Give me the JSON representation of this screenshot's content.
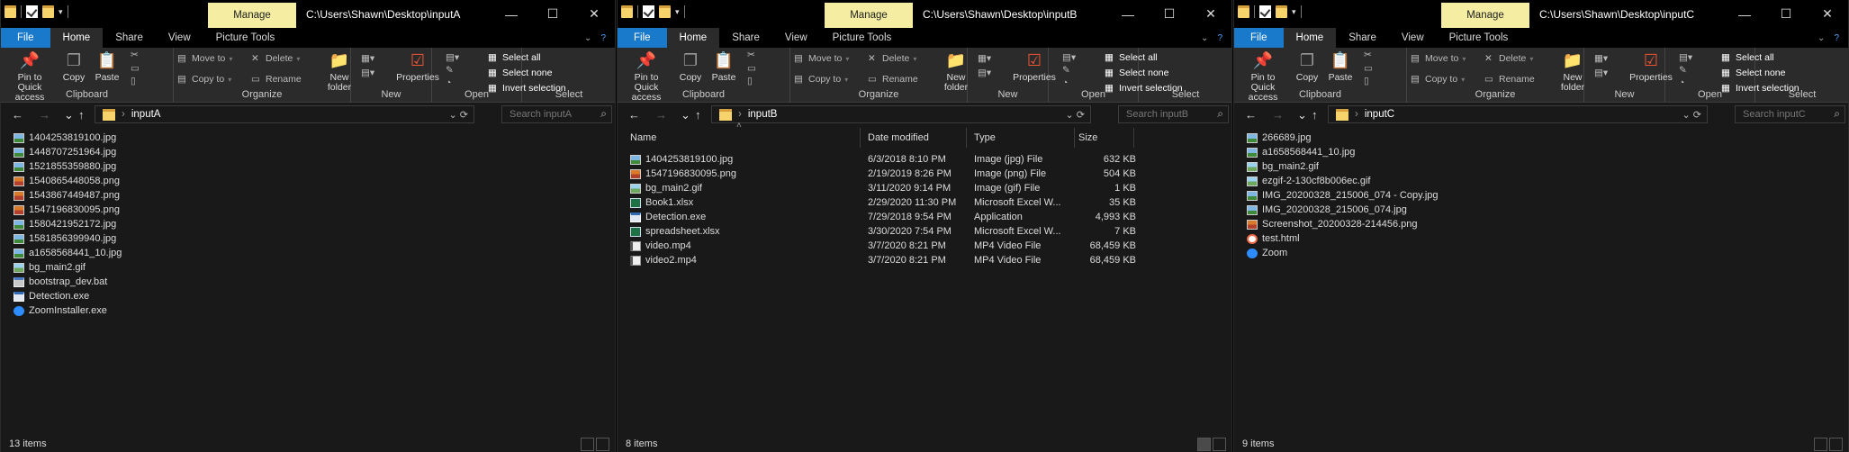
{
  "windows": [
    {
      "title": "C:\\Users\\Shawn\\Desktop\\inputA",
      "manage": "Manage",
      "tabs": [
        "File",
        "Home",
        "Share",
        "View",
        "Picture Tools"
      ],
      "ribbon": {
        "pin": "Pin to Quick access",
        "copy": "Copy",
        "paste": "Paste",
        "moveto": "Move to",
        "copyto": "Copy to",
        "delete": "Delete",
        "rename": "Rename",
        "newfolder": "New folder",
        "properties": "Properties",
        "selectall": "Select all",
        "selectnone": "Select none",
        "invert": "Invert selection",
        "groups": [
          "Clipboard",
          "Organize",
          "New",
          "Open",
          "Select"
        ]
      },
      "address": "inputA",
      "search_placeholder": "Search inputA",
      "view": "list",
      "files": [
        {
          "name": "1404253819100.jpg",
          "icon": "jpg"
        },
        {
          "name": "1448707251964.jpg",
          "icon": "jpg"
        },
        {
          "name": "1521855359880.jpg",
          "icon": "jpg"
        },
        {
          "name": "1540865448058.png",
          "icon": "png"
        },
        {
          "name": "1543867449487.png",
          "icon": "png"
        },
        {
          "name": "1547196830095.png",
          "icon": "png"
        },
        {
          "name": "1580421952172.jpg",
          "icon": "jpg"
        },
        {
          "name": "1581856399940.jpg",
          "icon": "jpg"
        },
        {
          "name": "a1658568441_10.jpg",
          "icon": "jpg"
        },
        {
          "name": "bg_main2.gif",
          "icon": "gif"
        },
        {
          "name": "bootstrap_dev.bat",
          "icon": "bat"
        },
        {
          "name": "Detection.exe",
          "icon": "exe"
        },
        {
          "name": "ZoomInstaller.exe",
          "icon": "zoomi"
        }
      ],
      "status": "13 items"
    },
    {
      "title": "C:\\Users\\Shawn\\Desktop\\inputB",
      "manage": "Manage",
      "tabs": [
        "File",
        "Home",
        "Share",
        "View",
        "Picture Tools"
      ],
      "ribbon": {
        "pin": "Pin to Quick access",
        "copy": "Copy",
        "paste": "Paste",
        "moveto": "Move to",
        "copyto": "Copy to",
        "delete": "Delete",
        "rename": "Rename",
        "newfolder": "New folder",
        "properties": "Properties",
        "selectall": "Select all",
        "selectnone": "Select none",
        "invert": "Invert selection",
        "groups": [
          "Clipboard",
          "Organize",
          "New",
          "Open",
          "Select"
        ]
      },
      "address": "inputB",
      "search_placeholder": "Search inputB",
      "view": "details",
      "columns": [
        "Name",
        "Date modified",
        "Type",
        "Size"
      ],
      "files": [
        {
          "name": "1404253819100.jpg",
          "icon": "jpg",
          "date": "6/3/2018 8:10 PM",
          "type": "Image (jpg) File",
          "size": "632 KB"
        },
        {
          "name": "1547196830095.png",
          "icon": "png",
          "date": "2/19/2019 8:26 PM",
          "type": "Image (png) File",
          "size": "504 KB"
        },
        {
          "name": "bg_main2.gif",
          "icon": "gif",
          "date": "3/11/2020 9:14 PM",
          "type": "Image (gif) File",
          "size": "1 KB"
        },
        {
          "name": "Book1.xlsx",
          "icon": "xls",
          "date": "2/29/2020 11:30 PM",
          "type": "Microsoft Excel W...",
          "size": "35 KB"
        },
        {
          "name": "Detection.exe",
          "icon": "exe",
          "date": "7/29/2018 9:54 PM",
          "type": "Application",
          "size": "4,993 KB"
        },
        {
          "name": "spreadsheet.xlsx",
          "icon": "xls",
          "date": "3/30/2020 7:54 PM",
          "type": "Microsoft Excel W...",
          "size": "7 KB"
        },
        {
          "name": "video.mp4",
          "icon": "mp4",
          "date": "3/7/2020 8:21 PM",
          "type": "MP4 Video File",
          "size": "68,459 KB"
        },
        {
          "name": "video2.mp4",
          "icon": "mp4",
          "date": "3/7/2020 8:21 PM",
          "type": "MP4 Video File",
          "size": "68,459 KB"
        }
      ],
      "status": "8 items"
    },
    {
      "title": "C:\\Users\\Shawn\\Desktop\\inputC",
      "manage": "Manage",
      "tabs": [
        "File",
        "Home",
        "Share",
        "View",
        "Picture Tools"
      ],
      "ribbon": {
        "pin": "Pin to Quick access",
        "copy": "Copy",
        "paste": "Paste",
        "moveto": "Move to",
        "copyto": "Copy to",
        "delete": "Delete",
        "rename": "Rename",
        "newfolder": "New folder",
        "properties": "Properties",
        "selectall": "Select all",
        "selectnone": "Select none",
        "invert": "Invert selection",
        "groups": [
          "Clipboard",
          "Organize",
          "New",
          "Open",
          "Select"
        ]
      },
      "address": "inputC",
      "search_placeholder": "Search inputC",
      "view": "list",
      "files": [
        {
          "name": "266689.jpg",
          "icon": "jpg"
        },
        {
          "name": "a1658568441_10.jpg",
          "icon": "jpg"
        },
        {
          "name": "bg_main2.gif",
          "icon": "gif"
        },
        {
          "name": "ezgif-2-130cf8b006ec.gif",
          "icon": "gif"
        },
        {
          "name": "IMG_20200328_215006_074 - Copy.jpg",
          "icon": "jpg"
        },
        {
          "name": "IMG_20200328_215006_074.jpg",
          "icon": "jpg"
        },
        {
          "name": "Screenshot_20200328-214456.png",
          "icon": "png"
        },
        {
          "name": "test.html",
          "icon": "html"
        },
        {
          "name": "Zoom",
          "icon": "zoomi"
        }
      ],
      "status": "9 items"
    }
  ]
}
